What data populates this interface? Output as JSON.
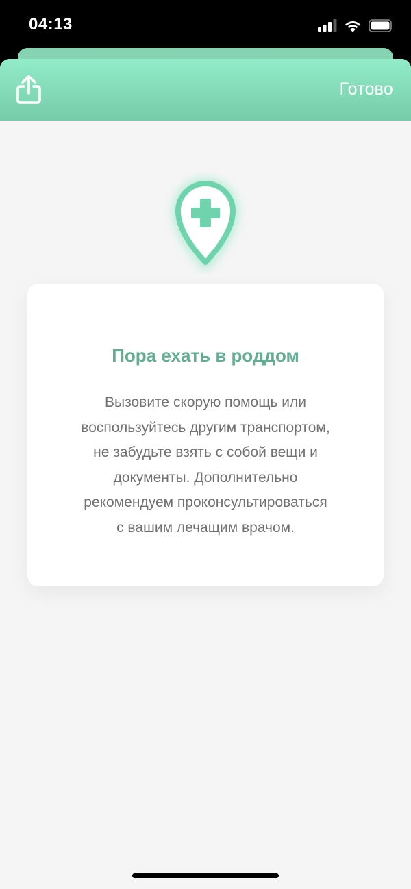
{
  "status_bar": {
    "time": "04:13",
    "icons": [
      "cellular-signal-icon",
      "wifi-icon",
      "battery-icon"
    ]
  },
  "nav": {
    "share_icon": "share-icon",
    "done_label": "Готово",
    "gradient_top": "#92ecc9",
    "gradient_bottom": "#76cba9"
  },
  "card": {
    "icon": "map-pin-medical-cross-icon",
    "title": "Пора ехать в роддом",
    "body": "Вызовите скорую помощь или\nвоспользуйтесь другим транспортом,\nне забудьте взять с собой вещи и\nдокументы. Дополнительно\nрекомендуем проконсультироваться\nс вашим лечащим врачом."
  },
  "colors": {
    "accent": "#6fd3ad",
    "title": "#63ad92",
    "body_text": "#717171",
    "background": "#f5f5f5"
  }
}
